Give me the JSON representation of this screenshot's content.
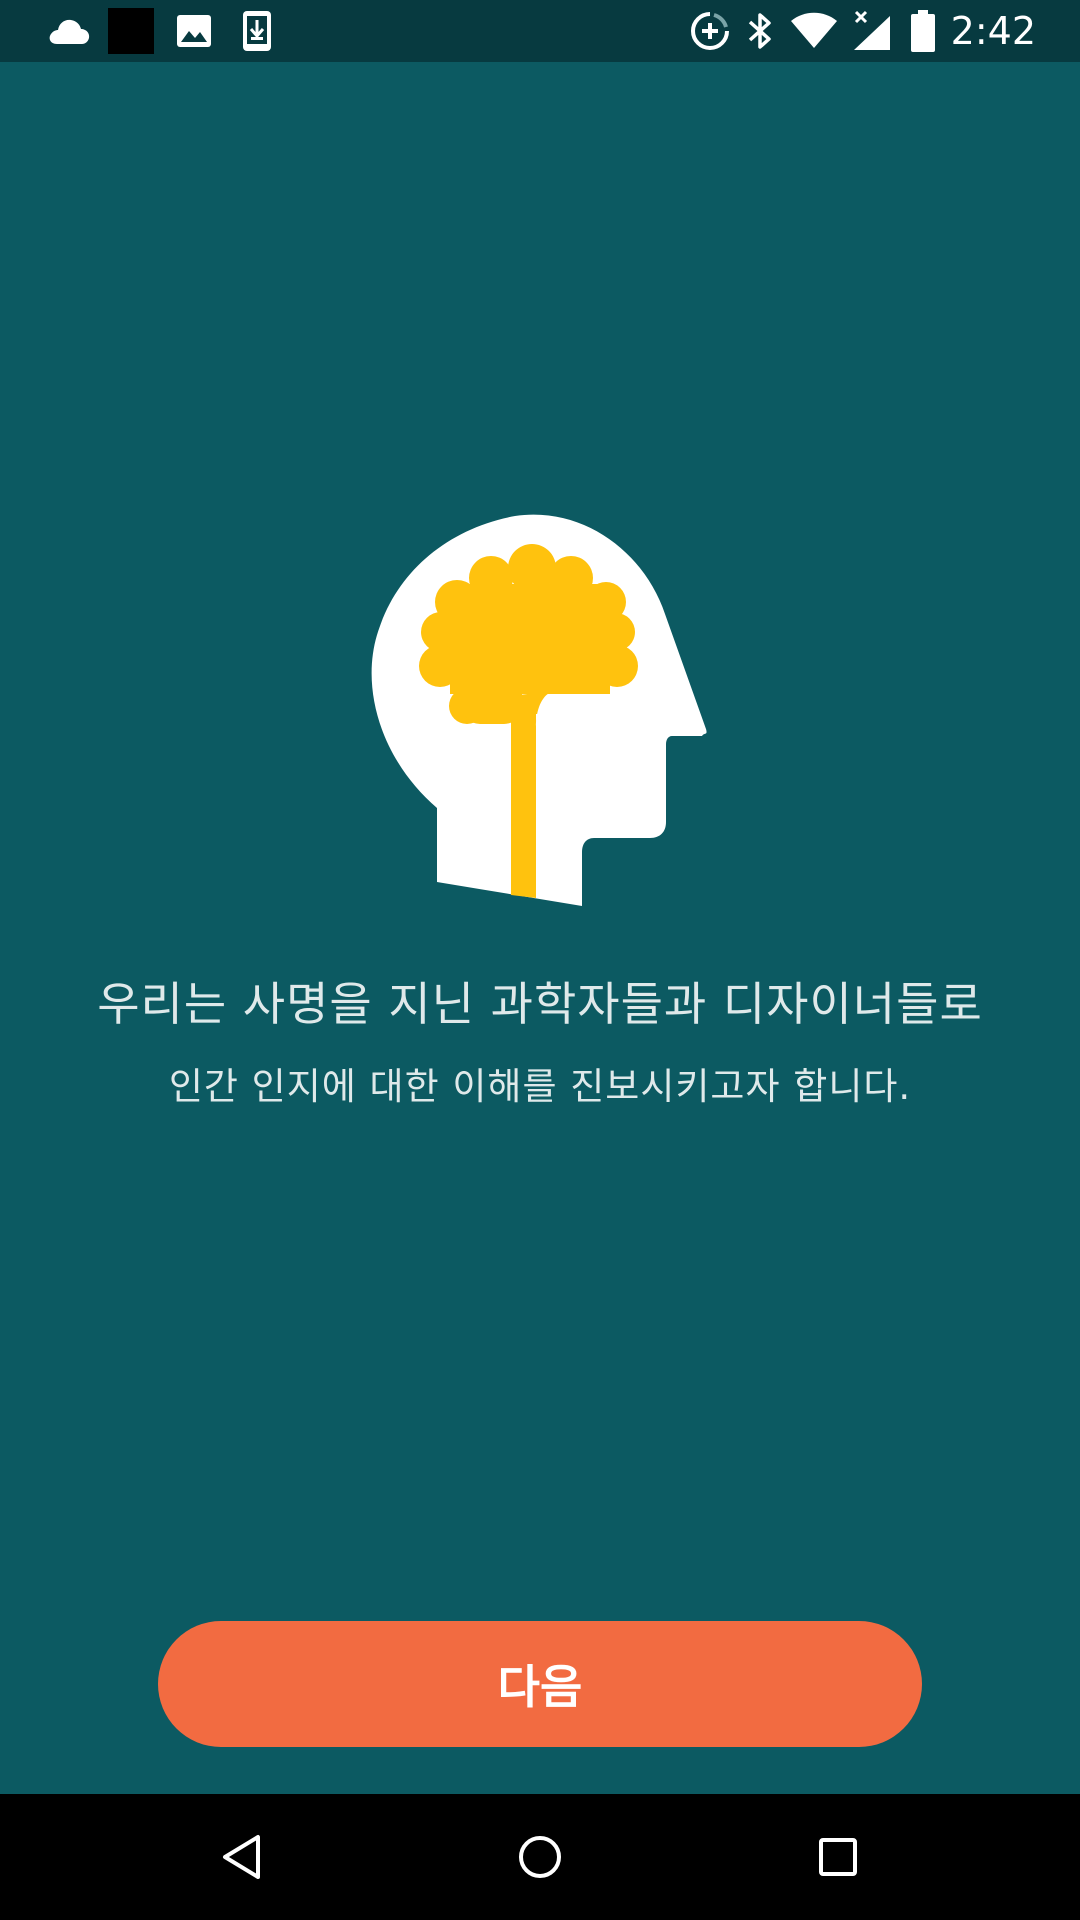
{
  "status_bar": {
    "time": "2:42",
    "left_icons": [
      "cloud-icon",
      "black-square-icon",
      "image-icon",
      "download-icon"
    ],
    "right_icons": [
      "data-saver-icon",
      "bluetooth-icon",
      "wifi-icon",
      "cell-signal-off-icon",
      "battery-icon"
    ]
  },
  "intro": {
    "headline": "우리는 사명을 지닌 과학자들과 디자이너들로",
    "subline": "인간 인지에 대한 이해를 진보시키고자 합니다."
  },
  "actions": {
    "next_label": "다음"
  },
  "nav_bar": {
    "buttons": [
      "back-icon",
      "home-icon",
      "recents-icon"
    ]
  },
  "colors": {
    "background": "#0c5a62",
    "status_bar": "#073a40",
    "accent_button": "#f26b41",
    "brain": "#ffc20e",
    "head": "#ffffff",
    "text": "#dfe9ea"
  }
}
